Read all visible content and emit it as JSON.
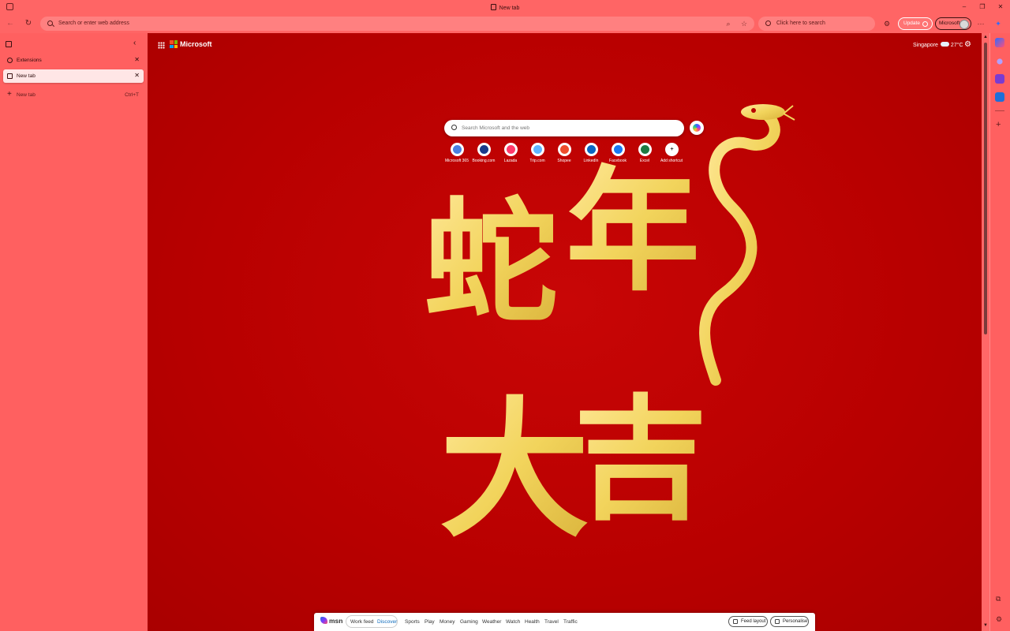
{
  "window": {
    "title": "New tab"
  },
  "toolbar": {
    "address_placeholder": "Search or enter web address",
    "search_placeholder": "Click here to search",
    "update_label": "Update",
    "profile_label": "Microsoft"
  },
  "sidebar": {
    "tabs": [
      {
        "label": "Extensions",
        "active": false
      },
      {
        "label": "New tab",
        "active": true
      }
    ],
    "new_tab": {
      "label": "New tab",
      "shortcut": "Ctrl+T"
    }
  },
  "page": {
    "brand": "Microsoft",
    "weather": {
      "location": "Singapore",
      "temp": "27°C"
    },
    "search_placeholder": "Search Microsoft and the web",
    "quick_links": [
      {
        "label": "Microsoft 365",
        "icon": "microsoft-365-icon",
        "color": "#4a7fe0"
      },
      {
        "label": "Booking.com",
        "icon": "booking-icon",
        "color": "#1a3a8a"
      },
      {
        "label": "Lazada",
        "icon": "lazada-icon",
        "color": "#ff3a6a"
      },
      {
        "label": "Trip.com",
        "icon": "trip-icon",
        "color": "#5fb4ff"
      },
      {
        "label": "Shopee",
        "icon": "shopee-icon",
        "color": "#ee4d2d"
      },
      {
        "label": "LinkedIn",
        "icon": "linkedin-icon",
        "color": "#0a66c2"
      },
      {
        "label": "Facebook",
        "icon": "facebook-icon",
        "color": "#1877f2"
      },
      {
        "label": "Excel",
        "icon": "excel-icon",
        "color": "#1d7a42"
      },
      {
        "label": "Add shortcut",
        "icon": "plus-icon",
        "color": "#ffffff"
      }
    ],
    "feed": {
      "logo": "msn",
      "tabs": [
        "Work feed",
        "Discover",
        "Sports",
        "Play",
        "Money",
        "Gaming",
        "Weather",
        "Watch",
        "Health",
        "Travel",
        "Traffic"
      ],
      "active_tab": "Discover",
      "feed_layout_label": "Feed layout",
      "personalise_label": "Personalise"
    },
    "background_text": "蛇年大吉"
  },
  "colors": {
    "chrome": "#ff6565",
    "page_background": "#b80000",
    "gold": "#f2d45c"
  }
}
